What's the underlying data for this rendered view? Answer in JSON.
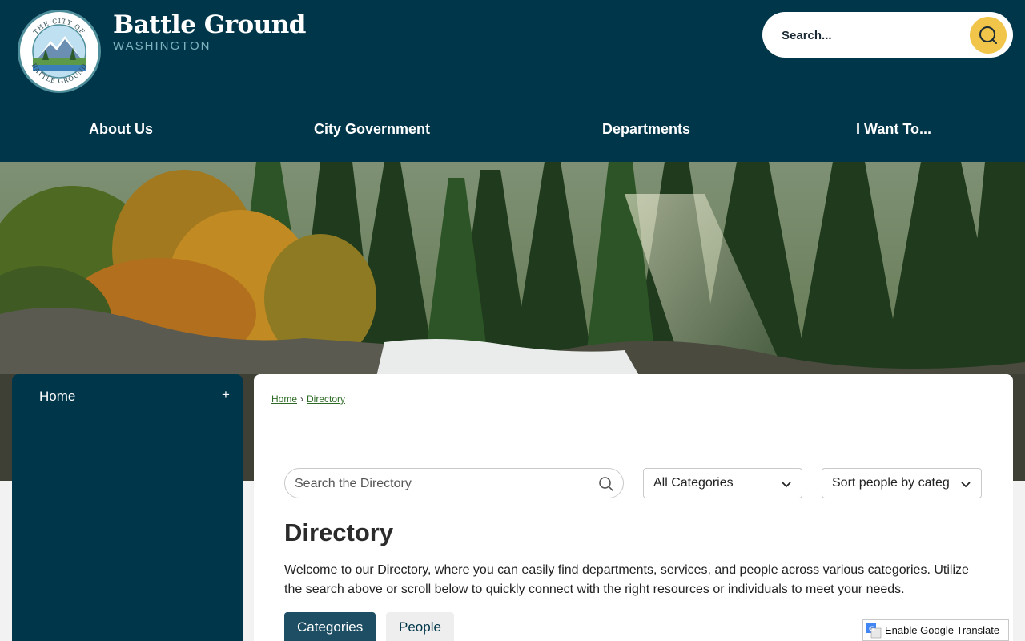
{
  "site": {
    "name": "Battle Ground",
    "state": "WASHINGTON",
    "seal_text_top": "THE CITY OF",
    "seal_text_bottom": "BATTLE GROUND"
  },
  "search": {
    "placeholder": "Search..."
  },
  "nav": {
    "items": [
      {
        "label": "About Us"
      },
      {
        "label": "City Government"
      },
      {
        "label": "Departments"
      },
      {
        "label": "I Want To..."
      }
    ]
  },
  "sidebar": {
    "home_label": "Home",
    "expand_symbol": "+"
  },
  "breadcrumb": {
    "home": "Home",
    "separator": "›",
    "current": "Directory"
  },
  "directory": {
    "search_placeholder": "Search the Directory",
    "category_select": "All Categories",
    "sort_select": "Sort people by categ",
    "title": "Directory",
    "intro": "Welcome to our Directory, where you can easily find departments, services, and people across various categories. Utilize the search above or scroll below to quickly connect with the right resources or individuals to meet your needs.",
    "tabs": [
      {
        "label": "Categories"
      },
      {
        "label": "People"
      }
    ]
  },
  "translate": {
    "label": "Enable Google Translate"
  },
  "colors": {
    "header_bg": "#00364a",
    "search_button": "#f0c54a",
    "active_tab": "#1d4e63",
    "breadcrumb_link": "#2e6b26"
  },
  "icons": {
    "search_button": "search-icon",
    "directory_search": "search-icon",
    "select_arrow": "chevron-down-icon",
    "translate": "google-translate-icon"
  }
}
